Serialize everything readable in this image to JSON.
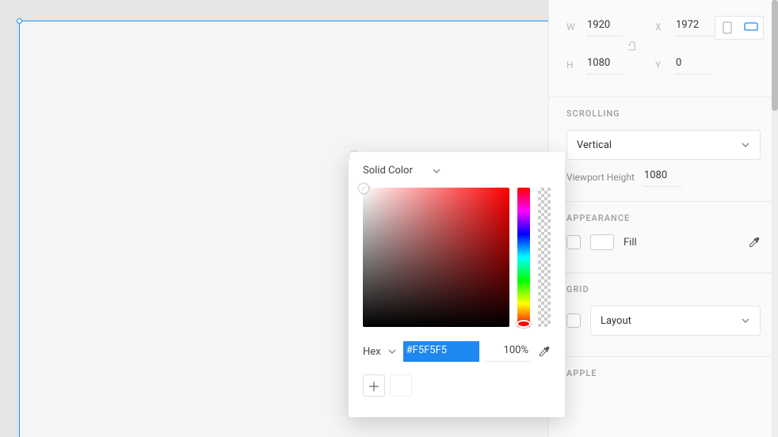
{
  "dimensions": {
    "w_label": "W",
    "w": "1920",
    "h_label": "H",
    "h": "1080",
    "x_label": "X",
    "x": "1972",
    "y_label": "Y",
    "y": "0"
  },
  "scrolling": {
    "title": "SCROLLING",
    "value": "Vertical",
    "viewport_label": "Viewport Height",
    "viewport_value": "1080"
  },
  "appearance": {
    "title": "APPEARANCE",
    "fill_label": "Fill"
  },
  "grid": {
    "title": "GRID",
    "value": "Layout"
  },
  "apple": {
    "title": "APPLE"
  },
  "picker": {
    "title": "Solid Color",
    "label": "Hex",
    "hex": "#F5F5F5",
    "opacity": "100%"
  }
}
